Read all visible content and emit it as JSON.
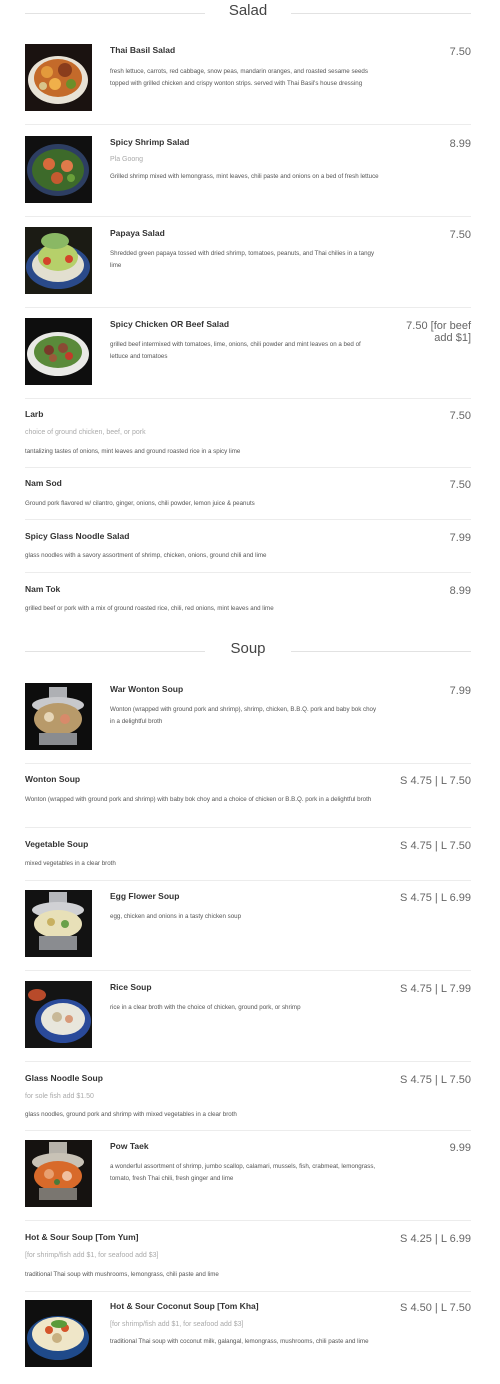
{
  "sections": [
    {
      "title": "Salad"
    },
    {
      "title": "Soup"
    }
  ],
  "items": [
    {
      "name": "Thai Basil Salad",
      "sub": "",
      "desc": "fresh lettuce, carrots, red cabbage, snow peas, mandarin oranges, and roasted sesame seeds topped with grilled chicken and crispy wonton strips. served with Thai Basil's house dressing",
      "price": "7.50"
    },
    {
      "name": "Spicy Shrimp Salad",
      "sub": "Pla Goong",
      "desc": "Grilled shrimp mixed with lemongrass, mint leaves, chili paste and onions on a bed of fresh lettuce",
      "price": "8.99"
    },
    {
      "name": "Papaya Salad",
      "sub": "",
      "desc": "Shredded green papaya tossed with dried shrimp, tomatoes, peanuts, and Thai chilies in a tangy lime",
      "price": "7.50"
    },
    {
      "name": "Spicy Chicken OR Beef Salad",
      "sub": "",
      "desc": "grilled beef intermixed with tomatoes, lime, onions, chili powder and mint leaves on a bed of lettuce and tomatoes",
      "price": "7.50 [for beef add $1]"
    },
    {
      "name": "Larb",
      "sub": "choice of ground chicken, beef, or pork",
      "desc": "tantalizing tastes of onions, mint leaves and ground roasted rice in a spicy lime",
      "price": "7.50"
    },
    {
      "name": "Nam Sod",
      "sub": "",
      "desc": "Ground pork flavored w/ cilantro, ginger, onions, chili powder, lemon juice & peanuts",
      "price": "7.50"
    },
    {
      "name": "Spicy Glass Noodle Salad",
      "sub": "",
      "desc": "glass noodles with a savory assortment of shrimp, chicken, onions, ground chili and lime",
      "price": "7.99"
    },
    {
      "name": "Nam Tok",
      "sub": "",
      "desc": "grilled beef or pork with a mix of ground roasted rice, chili, red onions, mint leaves and lime",
      "price": "8.99"
    },
    {
      "name": "War Wonton Soup",
      "sub": "",
      "desc": "Wonton (wrapped with ground pork and shrimp), shrimp, chicken, B.B.Q. pork and baby bok choy in a delightful broth",
      "price": "7.99"
    },
    {
      "name": "Wonton Soup",
      "sub": "",
      "desc": "Wonton (wrapped with ground pork and shrimp) with baby bok choy and a choice of chicken or B.B.Q. pork in a delightful broth",
      "price": "S 4.75 | L 7.50"
    },
    {
      "name": "Vegetable Soup",
      "sub": "",
      "desc": "mixed vegetables in a clear broth",
      "price": "S 4.75 | L 7.50"
    },
    {
      "name": "Egg Flower Soup",
      "sub": "",
      "desc": "egg, chicken and onions in a tasty chicken soup",
      "price": "S 4.75 | L 6.99"
    },
    {
      "name": "Rice Soup",
      "sub": "",
      "desc": "rice in a clear broth with the choice of chicken, ground pork, or shrimp",
      "price": "S 4.75 | L 7.99"
    },
    {
      "name": "Glass Noodle Soup",
      "sub": "for sole fish add $1.50",
      "desc": "glass noodles, ground pork and shrimp with mixed vegetables in a clear broth",
      "price": "S 4.75 | L 7.50"
    },
    {
      "name": "Pow Taek",
      "sub": "",
      "desc": "a wonderful assortment of shrimp, jumbo scallop, calamari, mussels, fish, crabmeat, lemongrass, tomato, fresh Thai chili, fresh ginger and lime",
      "price": "9.99"
    },
    {
      "name": "Hot & Sour Soup [Tom Yum]",
      "sub": "[for shrimp/fish add $1, for seafood add $3]",
      "desc": "traditional Thai soup with mushrooms, lemongrass, chili paste and lime",
      "price": "S 4.25 | L 6.99"
    },
    {
      "name": "Hot & Sour Coconut Soup [Tom Kha]",
      "sub": "[for shrimp/fish add $1, for seafood add $3]",
      "desc": "traditional Thai soup with coconut milk, galangal, lemongrass, mushrooms, chili paste and lime",
      "price": "S 4.50 | L 7.50"
    }
  ]
}
